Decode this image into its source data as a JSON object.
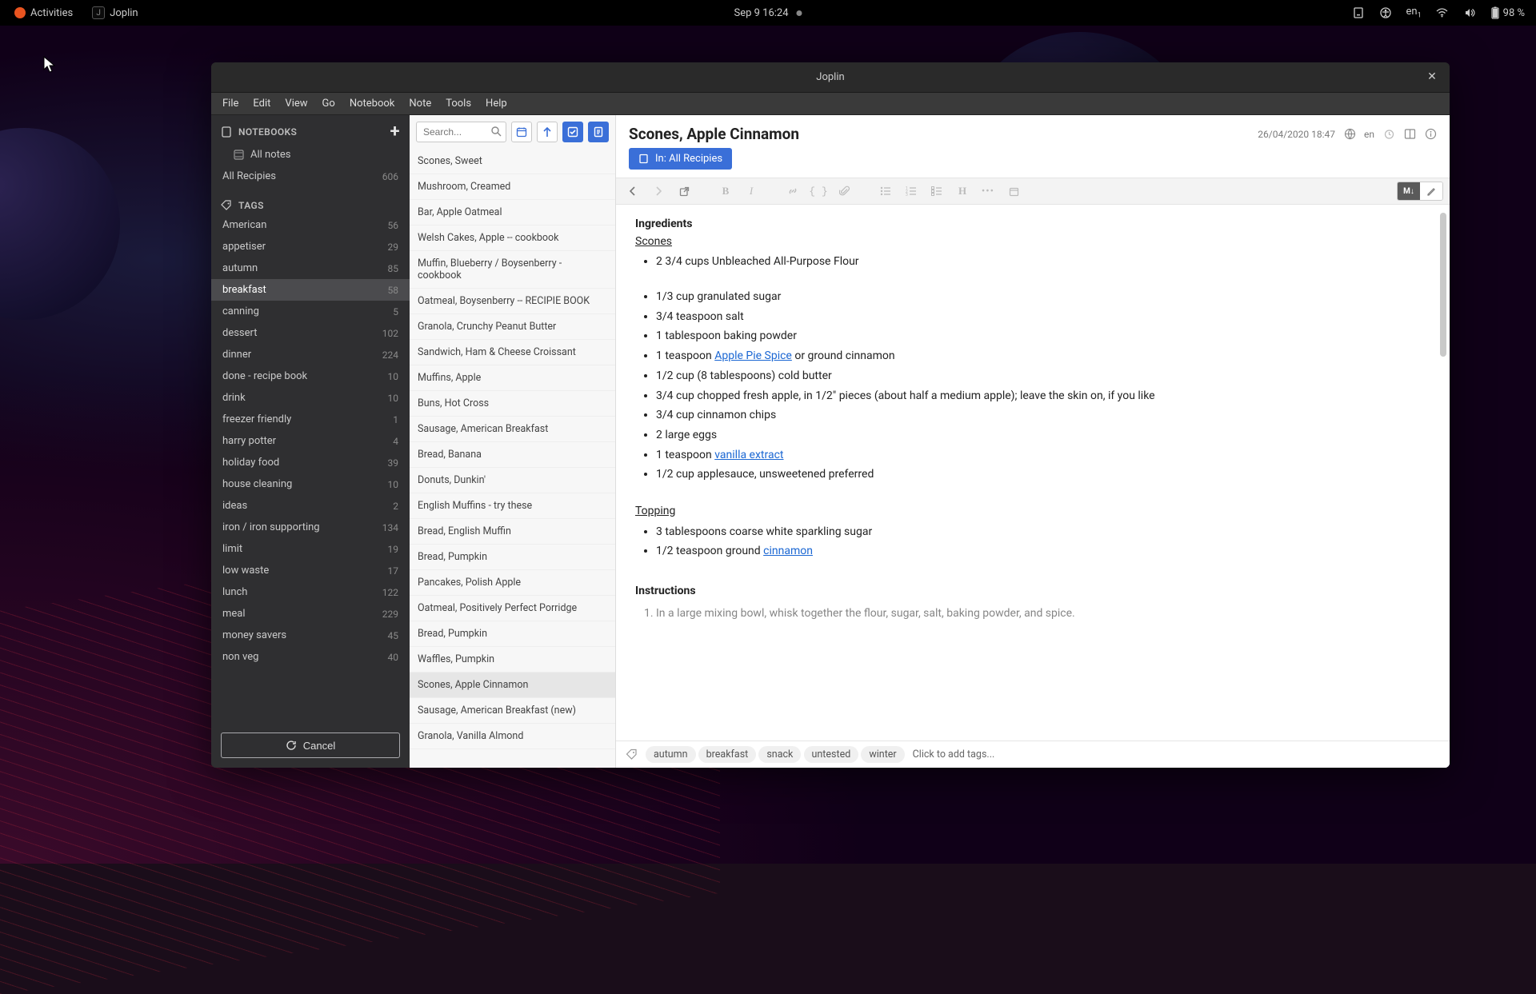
{
  "topbar": {
    "activities": "Activities",
    "app_name": "Joplin",
    "clock": "Sep 9  16:24",
    "lang": "en",
    "battery": "98 %"
  },
  "window": {
    "title": "Joplin"
  },
  "menu": {
    "file": "File",
    "edit": "Edit",
    "view": "View",
    "go": "Go",
    "notebook": "Notebook",
    "note": "Note",
    "tools": "Tools",
    "help": "Help"
  },
  "sidebar": {
    "notebooks_header": "NOTEBOOKS",
    "all_notes": "All notes",
    "all_recipies": {
      "label": "All Recipies",
      "count": "606"
    },
    "tags_header": "TAGS",
    "tags": [
      {
        "label": "American",
        "count": "56"
      },
      {
        "label": "appetiser",
        "count": "29"
      },
      {
        "label": "autumn",
        "count": "85"
      },
      {
        "label": "breakfast",
        "count": "58",
        "selected": true
      },
      {
        "label": "canning",
        "count": "5"
      },
      {
        "label": "dessert",
        "count": "102"
      },
      {
        "label": "dinner",
        "count": "224"
      },
      {
        "label": "done - recipe book",
        "count": "10"
      },
      {
        "label": "drink",
        "count": "10"
      },
      {
        "label": "freezer friendly",
        "count": "1"
      },
      {
        "label": "harry potter",
        "count": "4"
      },
      {
        "label": "holiday food",
        "count": "39"
      },
      {
        "label": "house cleaning",
        "count": "10"
      },
      {
        "label": "ideas",
        "count": "2"
      },
      {
        "label": "iron / iron supporting",
        "count": "134"
      },
      {
        "label": "limit",
        "count": "19"
      },
      {
        "label": "low waste",
        "count": "17"
      },
      {
        "label": "lunch",
        "count": "122"
      },
      {
        "label": "meal",
        "count": "229"
      },
      {
        "label": "money savers",
        "count": "45"
      },
      {
        "label": "non veg",
        "count": "40"
      }
    ],
    "cancel": "Cancel"
  },
  "notelist": {
    "search_placeholder": "Search...",
    "items": [
      "Scones, Sweet",
      "Mushroom, Creamed",
      "Bar, Apple Oatmeal",
      "Welsh Cakes, Apple -- cookbook",
      "Muffin, Blueberry / Boysenberry - cookbook",
      "Oatmeal, Boysenberry -- RECIPIE BOOK",
      "Granola, Crunchy Peanut Butter",
      "Sandwich, Ham & Cheese Croissant",
      "Muffins, Apple",
      "Buns, Hot Cross",
      "Sausage, American Breakfast",
      "Bread, Banana",
      "Donuts, Dunkin'",
      "English Muffins - try these",
      "Bread, English Muffin",
      "Bread, Pumpkin",
      "Pancakes, Polish Apple",
      "Oatmeal, Positively Perfect Porridge",
      "Bread, Pumpkin",
      "Waffles, Pumpkin",
      "Scones, Apple Cinnamon",
      "Sausage, American Breakfast (new)",
      "Granola, Vanilla Almond"
    ],
    "selected_index": 20
  },
  "editor": {
    "title": "Scones, Apple Cinnamon",
    "date": "26/04/2020 18:47",
    "lang": "en",
    "in_button_prefix": "In: ",
    "in_button_label": "All Recipies",
    "sections": {
      "ingredients": "Ingredients",
      "scones": "Scones",
      "topping": "Topping",
      "instructions": "Instructions"
    },
    "ing_scones": [
      [
        "2 3/4 cups Unbleached All-Purpose Flour"
      ],
      [
        "1/3 cup granulated sugar"
      ],
      [
        "3/4 teaspoon salt"
      ],
      [
        "1 tablespoon baking powder"
      ],
      [
        "1 teaspoon ",
        {
          "link": "Apple Pie Spice"
        },
        " or ground cinnamon"
      ],
      [
        "1/2 cup (8 tablespoons) cold butter"
      ],
      [
        "3/4 cup chopped fresh apple, in 1/2\" pieces (about half a medium apple); leave the skin on, if you like"
      ],
      [
        "3/4 cup cinnamon chips"
      ],
      [
        "2 large eggs"
      ],
      [
        "1 teaspoon ",
        {
          "link": "vanilla extract"
        }
      ],
      [
        "1/2 cup applesauce, unsweetened preferred"
      ]
    ],
    "ing_topping": [
      [
        "3 tablespoons coarse white sparkling sugar"
      ],
      [
        "1/2 teaspoon ground ",
        {
          "link": "cinnamon"
        }
      ]
    ],
    "instr_first": "In a large mixing bowl, whisk together the flour, sugar, salt, baking powder, and spice.",
    "tagbar": {
      "tags": [
        "autumn",
        "breakfast",
        "snack",
        "untested",
        "winter"
      ],
      "add": "Click to add tags..."
    }
  }
}
